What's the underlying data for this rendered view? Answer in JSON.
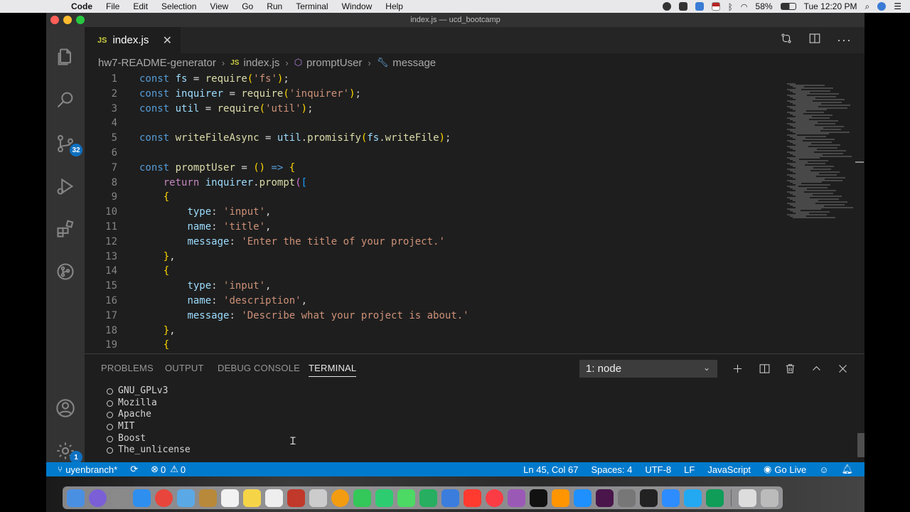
{
  "menubar": {
    "app_name": "Code",
    "items": [
      "File",
      "Edit",
      "Selection",
      "View",
      "Go",
      "Run",
      "Terminal",
      "Window",
      "Help"
    ],
    "battery": "58%",
    "clock": "Tue 12:20 PM"
  },
  "window": {
    "title": "index.js — ucd_bootcamp"
  },
  "activity_bar": {
    "icons": [
      "files-icon",
      "search-icon",
      "source-control-icon",
      "run-debug-icon",
      "extensions-icon",
      "git-graph-icon"
    ],
    "source_control_badge": "32",
    "accounts_icon": "account-icon",
    "settings_icon": "gear-icon",
    "settings_badge": "1"
  },
  "tab": {
    "badge": "JS",
    "label": "index.js",
    "close": "✕"
  },
  "breadcrumb": {
    "folder": "hw7-README-generator",
    "file_badge": "JS",
    "file": "index.js",
    "function": "promptUser",
    "property": "message"
  },
  "code": {
    "line_numbers": [
      "1",
      "2",
      "3",
      "4",
      "5",
      "6",
      "7",
      "8",
      "9",
      "10",
      "11",
      "12",
      "13",
      "14",
      "15",
      "16",
      "17",
      "18",
      "19"
    ]
  },
  "panel": {
    "tabs": [
      "PROBLEMS",
      "OUTPUT",
      "DEBUG CONSOLE",
      "TERMINAL"
    ],
    "active_tab": "TERMINAL",
    "terminal_select": "1: node",
    "terminal_lines": [
      "GNU_GPLv3",
      "Mozilla",
      "Apache",
      "MIT",
      "Boost",
      "The_unlicense"
    ]
  },
  "status_bar": {
    "branch": "uyenbranch*",
    "errors": "0",
    "warnings": "0",
    "position": "Ln 45, Col 67",
    "spaces": "Spaces: 4",
    "encoding": "UTF-8",
    "eol": "LF",
    "language": "JavaScript",
    "go_live": "Go Live"
  },
  "colors": {
    "status_bar": "#007acc",
    "editor_bg": "#1e1e1e",
    "activity_bar": "#333333",
    "keyword": "#569cd6",
    "string": "#ce9178",
    "function": "#dcdcaa",
    "variable": "#9cdcfe"
  },
  "dock": {
    "apps": [
      "finder-icon",
      "siri-icon",
      "launchpad-icon",
      "safari-icon",
      "chrome-icon",
      "preview-icon",
      "archive-icon",
      "calendar-icon",
      "notes-icon",
      "reminders-icon",
      "photo-booth-icon",
      "help-icon",
      "photos-icon",
      "messages-icon",
      "facetime-icon",
      "maps-icon",
      "numbers-icon",
      "keynote-icon",
      "news-icon",
      "music-icon",
      "podcasts-icon",
      "tv-icon",
      "books-icon",
      "app-store-icon",
      "slack-icon",
      "system-preferences-icon",
      "terminal-icon",
      "zoom-icon",
      "vscode-icon",
      "webex-icon",
      "finder-window-icon",
      "trash-icon"
    ]
  }
}
